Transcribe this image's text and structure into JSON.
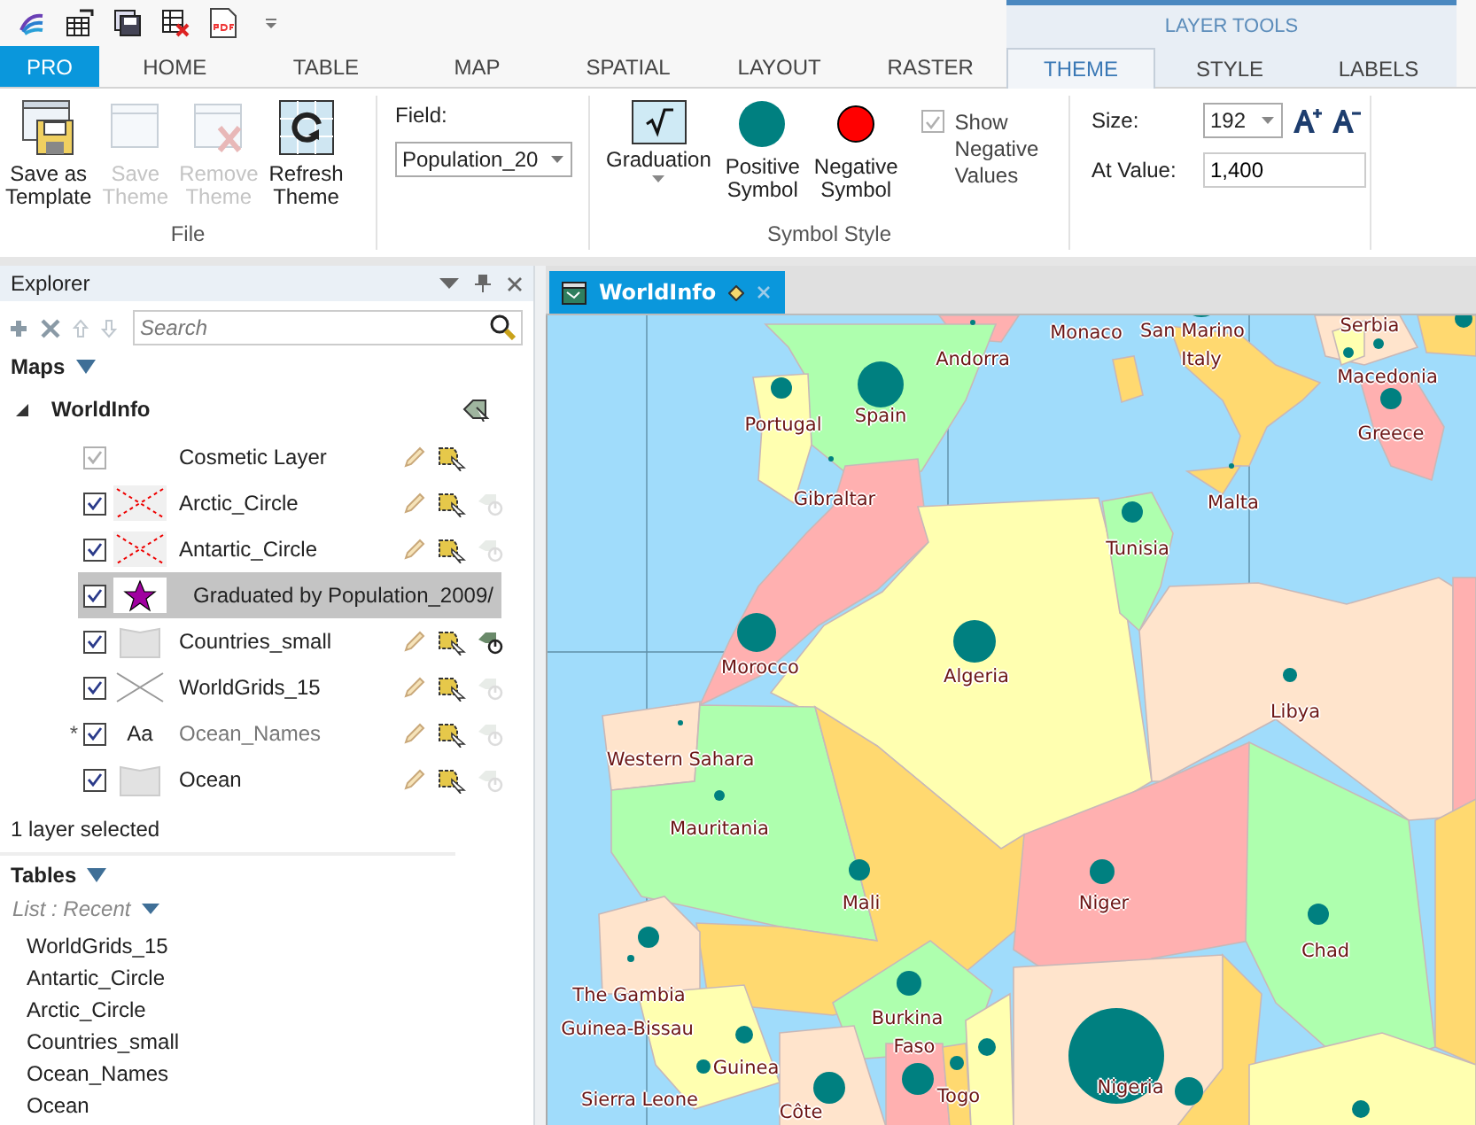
{
  "ribbon": {
    "context_header": "LAYER TOOLS",
    "tabs": [
      {
        "label": "PRO",
        "kind": "app",
        "selected": false
      },
      {
        "label": "HOME",
        "kind": "main",
        "selected": false
      },
      {
        "label": "TABLE",
        "kind": "main",
        "selected": false
      },
      {
        "label": "MAP",
        "kind": "main",
        "selected": false
      },
      {
        "label": "SPATIAL",
        "kind": "main",
        "selected": false
      },
      {
        "label": "LAYOUT",
        "kind": "main",
        "selected": false
      },
      {
        "label": "RASTER",
        "kind": "main",
        "selected": false
      },
      {
        "label": "THEME",
        "kind": "context",
        "selected": true
      },
      {
        "label": "STYLE",
        "kind": "context",
        "selected": false
      },
      {
        "label": "LABELS",
        "kind": "context",
        "selected": false
      }
    ],
    "file_group": {
      "label": "File",
      "buttons": [
        {
          "kind": "save-template",
          "lines": [
            "Save as",
            "Template"
          ],
          "disabled": false
        },
        {
          "kind": "save-theme",
          "lines": [
            "Save",
            "Theme"
          ],
          "disabled": true
        },
        {
          "kind": "remove-theme",
          "lines": [
            "Remove",
            "Theme"
          ],
          "disabled": true
        },
        {
          "kind": "refresh",
          "lines": [
            "Refresh",
            "Theme"
          ],
          "disabled": false
        }
      ]
    },
    "field": {
      "label": "Field:",
      "value": "Population_20"
    },
    "symbol_style": {
      "label": "Symbol Style",
      "graduation": "Graduation",
      "symbols": [
        {
          "kind": "positive",
          "lines": [
            "Positive",
            "Symbol"
          ]
        },
        {
          "kind": "negative",
          "lines": [
            "Negative",
            "Symbol"
          ]
        }
      ],
      "show_negative": {
        "lines": [
          "Show",
          "Negative",
          "Values"
        ],
        "checked": true,
        "disabled": true
      }
    },
    "size": {
      "label": "Size:",
      "value": "192"
    },
    "at_value": {
      "label": "At Value:",
      "value": "1,400"
    }
  },
  "explorer": {
    "title": "Explorer",
    "search": {
      "placeholder": "Search"
    },
    "maps_heading": "Maps",
    "map": {
      "name": "WorldInfo",
      "expanded": true,
      "layers": [
        {
          "name": "Cosmetic Layer",
          "kind": "cosmetic",
          "checked": true,
          "disabled": true,
          "selected": false,
          "dimmed": false,
          "tool_active": false
        },
        {
          "name": "Arctic_Circle",
          "kind": "line",
          "checked": true,
          "disabled": false,
          "selected": false,
          "dimmed": false,
          "tool_active": false
        },
        {
          "name": "Antartic_Circle",
          "kind": "line",
          "checked": true,
          "disabled": false,
          "selected": false,
          "dimmed": false,
          "tool_active": false
        },
        {
          "name": "Graduated by Population_2009/",
          "kind": "theme",
          "checked": true,
          "disabled": false,
          "selected": true,
          "dimmed": false,
          "tool_active": false
        },
        {
          "name": "Countries_small",
          "kind": "region",
          "checked": true,
          "disabled": false,
          "selected": false,
          "dimmed": false,
          "tool_active": true
        },
        {
          "name": "WorldGrids_15",
          "kind": "grid",
          "checked": true,
          "disabled": false,
          "selected": false,
          "dimmed": false,
          "tool_active": false
        },
        {
          "name": "Ocean_Names",
          "kind": "text",
          "marker": "*",
          "swatch_text": "Aa",
          "checked": true,
          "disabled": false,
          "selected": false,
          "dimmed": true,
          "tool_active": false
        },
        {
          "name": "Ocean",
          "kind": "region",
          "checked": true,
          "disabled": false,
          "selected": false,
          "dimmed": false,
          "tool_active": false
        }
      ]
    },
    "status": "1 layer selected",
    "tables_heading": "Tables",
    "list_mode": "List : Recent",
    "tables": [
      "WorldGrids_15",
      "Antartic_Circle",
      "Arctic_Circle",
      "Countries_small",
      "Ocean_Names",
      "Ocean"
    ]
  },
  "map_view": {
    "tab": {
      "title": "WorldInfo",
      "modified": true
    },
    "labels": [
      "Monaco",
      "San Marino",
      "Italy",
      "Serbia",
      "Andorra",
      "Macedonia",
      "Portugal",
      "Spain",
      "Greece",
      "Gibraltar",
      "Malta",
      "Tunisia",
      "Morocco",
      "Algeria",
      "Libya",
      "Western Sahara",
      "Mauritania",
      "Mali",
      "Niger",
      "Chad",
      "The Gambia",
      "Guinea-Bissau",
      "Burkina",
      "Faso",
      "Guinea",
      "Nigeria",
      "Sierra Leone",
      "Togo",
      "Côte"
    ]
  }
}
